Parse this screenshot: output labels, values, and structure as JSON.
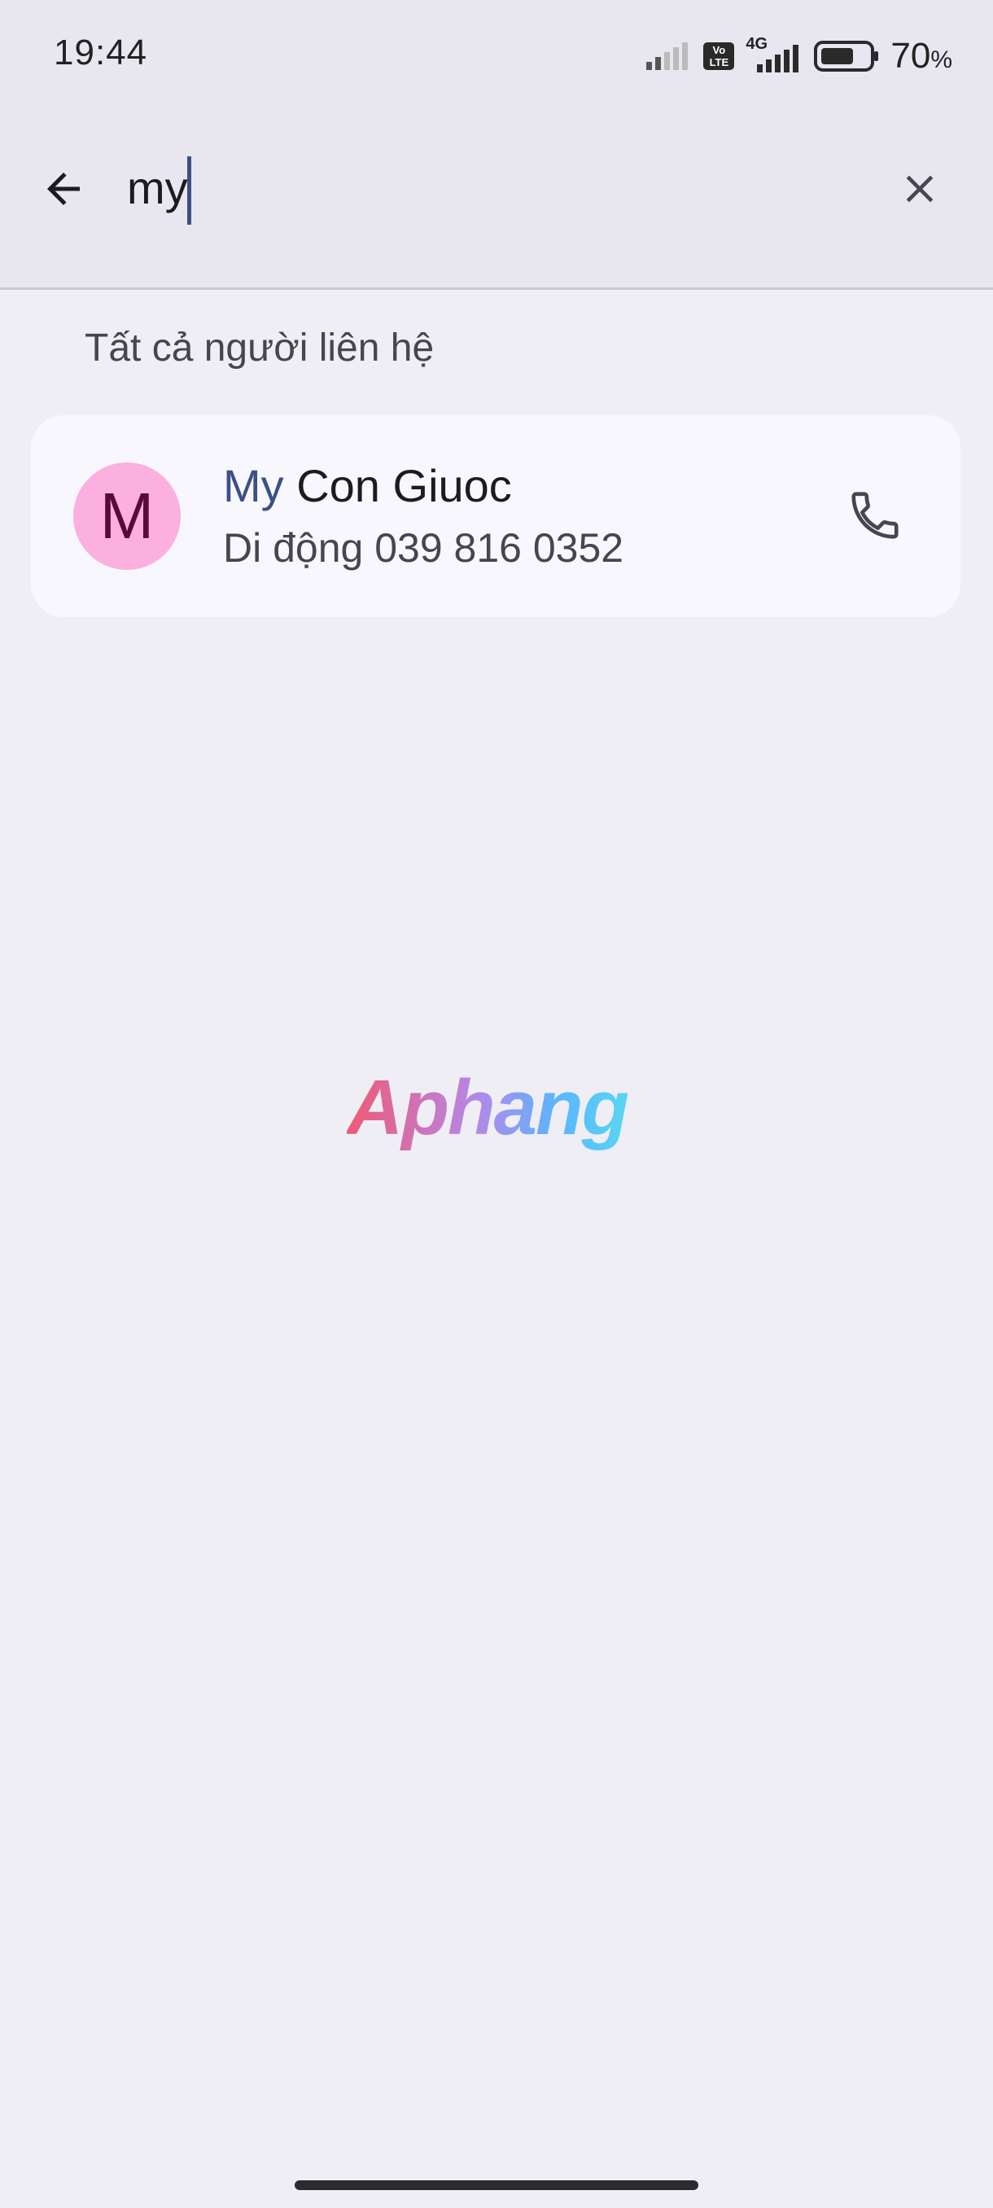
{
  "status_bar": {
    "time": "19:44",
    "network_type": "4G",
    "volte_badge": "Vo LTE",
    "battery_percent": "70",
    "battery_unit": "%",
    "battery_level": 0.7
  },
  "search": {
    "query": "my",
    "back_icon": "arrow-left-icon",
    "clear_icon": "close-icon"
  },
  "results": {
    "section_header": "Tất cả người liên hệ",
    "contacts": [
      {
        "avatar_letter": "M",
        "avatar_color": "#fbb0e0",
        "name_match": "My",
        "name_rest": " Con Giuoc",
        "phone_label": "Di động 039 816 0352",
        "action_icon": "phone-icon"
      }
    ]
  },
  "watermark": "Aphang",
  "colors": {
    "accent": "#3c4f86",
    "background": "#efeef4",
    "card": "#f8f7fd"
  }
}
